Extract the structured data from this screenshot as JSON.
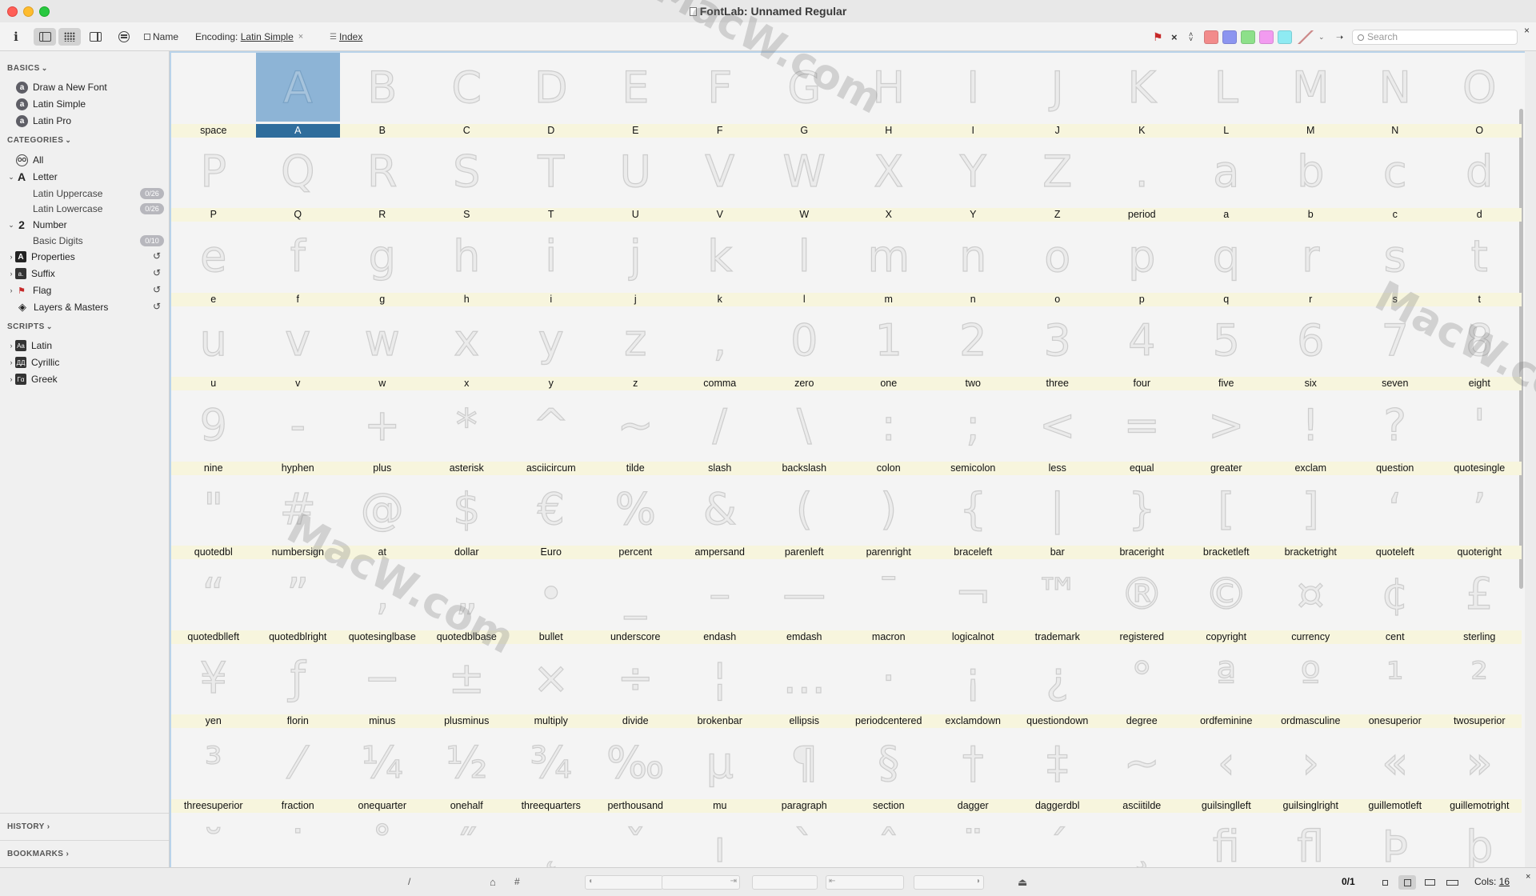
{
  "window": {
    "title": "FontLab: Unnamed Regular"
  },
  "toolbar": {
    "info_label": "i",
    "name_label": "Name",
    "encoding_label": "Encoding:",
    "encoding_value": "Latin Simple",
    "encoding_close": "×",
    "index_label": "Index",
    "flag_close": "×",
    "search_placeholder": "Search",
    "close_x": "×",
    "colors": {
      "red": "#f28b8b",
      "blue": "#8c95f0",
      "green": "#8de08a",
      "magenta": "#f29bf0",
      "cyan": "#8eeaf2"
    }
  },
  "sidebar": {
    "basics_title": "BASICS",
    "basics": [
      {
        "label": "Draw a New Font"
      },
      {
        "label": "Latin Simple"
      },
      {
        "label": "Latin Pro"
      }
    ],
    "categories_title": "CATEGORIES",
    "all_label": "All",
    "all_icon_text": "OO",
    "letter_label": "Letter",
    "letter_icon": "A",
    "latin_upper": {
      "label": "Latin Uppercase",
      "badge": "0/26"
    },
    "latin_lower": {
      "label": "Latin Lowercase",
      "badge": "0/26"
    },
    "number_label": "Number",
    "number_icon": "2",
    "basic_digits": {
      "label": "Basic Digits",
      "badge": "0/10"
    },
    "properties_label": "Properties",
    "suffix_label": "Suffix",
    "flag_label": "Flag",
    "layers_label": "Layers & Masters",
    "scripts_title": "SCRIPTS",
    "scripts": [
      {
        "label": "Latin",
        "icon": "Aa"
      },
      {
        "label": "Cyrillic",
        "icon": "ДД"
      },
      {
        "label": "Greek",
        "icon": "Γα"
      }
    ],
    "history_label": "HISTORY",
    "bookmarks_label": "BOOKMARKS"
  },
  "glyph_grid": {
    "columns": 16,
    "selected": "A",
    "cells": [
      {
        "g": "",
        "n": "space"
      },
      {
        "g": "A",
        "n": "A"
      },
      {
        "g": "B",
        "n": "B"
      },
      {
        "g": "C",
        "n": "C"
      },
      {
        "g": "D",
        "n": "D"
      },
      {
        "g": "E",
        "n": "E"
      },
      {
        "g": "F",
        "n": "F"
      },
      {
        "g": "G",
        "n": "G"
      },
      {
        "g": "H",
        "n": "H"
      },
      {
        "g": "I",
        "n": "I"
      },
      {
        "g": "J",
        "n": "J"
      },
      {
        "g": "K",
        "n": "K"
      },
      {
        "g": "L",
        "n": "L"
      },
      {
        "g": "M",
        "n": "M"
      },
      {
        "g": "N",
        "n": "N"
      },
      {
        "g": "O",
        "n": "O"
      },
      {
        "g": "P",
        "n": "P"
      },
      {
        "g": "Q",
        "n": "Q"
      },
      {
        "g": "R",
        "n": "R"
      },
      {
        "g": "S",
        "n": "S"
      },
      {
        "g": "T",
        "n": "T"
      },
      {
        "g": "U",
        "n": "U"
      },
      {
        "g": "V",
        "n": "V"
      },
      {
        "g": "W",
        "n": "W"
      },
      {
        "g": "X",
        "n": "X"
      },
      {
        "g": "Y",
        "n": "Y"
      },
      {
        "g": "Z",
        "n": "Z"
      },
      {
        "g": ".",
        "n": "period"
      },
      {
        "g": "a",
        "n": "a"
      },
      {
        "g": "b",
        "n": "b"
      },
      {
        "g": "c",
        "n": "c"
      },
      {
        "g": "d",
        "n": "d"
      },
      {
        "g": "e",
        "n": "e"
      },
      {
        "g": "f",
        "n": "f"
      },
      {
        "g": "g",
        "n": "g"
      },
      {
        "g": "h",
        "n": "h"
      },
      {
        "g": "i",
        "n": "i"
      },
      {
        "g": "j",
        "n": "j"
      },
      {
        "g": "k",
        "n": "k"
      },
      {
        "g": "l",
        "n": "l"
      },
      {
        "g": "m",
        "n": "m"
      },
      {
        "g": "n",
        "n": "n"
      },
      {
        "g": "o",
        "n": "o"
      },
      {
        "g": "p",
        "n": "p"
      },
      {
        "g": "q",
        "n": "q"
      },
      {
        "g": "r",
        "n": "r"
      },
      {
        "g": "s",
        "n": "s"
      },
      {
        "g": "t",
        "n": "t"
      },
      {
        "g": "u",
        "n": "u"
      },
      {
        "g": "v",
        "n": "v"
      },
      {
        "g": "w",
        "n": "w"
      },
      {
        "g": "x",
        "n": "x"
      },
      {
        "g": "y",
        "n": "y"
      },
      {
        "g": "z",
        "n": "z"
      },
      {
        "g": ",",
        "n": "comma"
      },
      {
        "g": "0",
        "n": "zero"
      },
      {
        "g": "1",
        "n": "one"
      },
      {
        "g": "2",
        "n": "two"
      },
      {
        "g": "3",
        "n": "three"
      },
      {
        "g": "4",
        "n": "four"
      },
      {
        "g": "5",
        "n": "five"
      },
      {
        "g": "6",
        "n": "six"
      },
      {
        "g": "7",
        "n": "seven"
      },
      {
        "g": "8",
        "n": "eight"
      },
      {
        "g": "9",
        "n": "nine"
      },
      {
        "g": "-",
        "n": "hyphen"
      },
      {
        "g": "+",
        "n": "plus"
      },
      {
        "g": "*",
        "n": "asterisk"
      },
      {
        "g": "^",
        "n": "asciicircum"
      },
      {
        "g": "~",
        "n": "tilde"
      },
      {
        "g": "/",
        "n": "slash"
      },
      {
        "g": "\\",
        "n": "backslash"
      },
      {
        "g": ":",
        "n": "colon"
      },
      {
        "g": ";",
        "n": "semicolon"
      },
      {
        "g": "<",
        "n": "less"
      },
      {
        "g": "=",
        "n": "equal"
      },
      {
        "g": ">",
        "n": "greater"
      },
      {
        "g": "!",
        "n": "exclam"
      },
      {
        "g": "?",
        "n": "question"
      },
      {
        "g": "'",
        "n": "quotesingle"
      },
      {
        "g": "\"",
        "n": "quotedbl"
      },
      {
        "g": "#",
        "n": "numbersign"
      },
      {
        "g": "@",
        "n": "at"
      },
      {
        "g": "$",
        "n": "dollar"
      },
      {
        "g": "€",
        "n": "Euro"
      },
      {
        "g": "%",
        "n": "percent"
      },
      {
        "g": "&",
        "n": "ampersand"
      },
      {
        "g": "(",
        "n": "parenleft"
      },
      {
        "g": ")",
        "n": "parenright"
      },
      {
        "g": "{",
        "n": "braceleft"
      },
      {
        "g": "|",
        "n": "bar"
      },
      {
        "g": "}",
        "n": "braceright"
      },
      {
        "g": "[",
        "n": "bracketleft"
      },
      {
        "g": "]",
        "n": "bracketright"
      },
      {
        "g": "‘",
        "n": "quoteleft"
      },
      {
        "g": "’",
        "n": "quoteright"
      },
      {
        "g": "“",
        "n": "quotedblleft"
      },
      {
        "g": "”",
        "n": "quotedblright"
      },
      {
        "g": "‚",
        "n": "quotesinglbase"
      },
      {
        "g": "„",
        "n": "quotedblbase"
      },
      {
        "g": "•",
        "n": "bullet"
      },
      {
        "g": "_",
        "n": "underscore"
      },
      {
        "g": "–",
        "n": "endash"
      },
      {
        "g": "—",
        "n": "emdash"
      },
      {
        "g": "¯",
        "n": "macron"
      },
      {
        "g": "¬",
        "n": "logicalnot"
      },
      {
        "g": "™",
        "n": "trademark"
      },
      {
        "g": "®",
        "n": "registered"
      },
      {
        "g": "©",
        "n": "copyright"
      },
      {
        "g": "¤",
        "n": "currency"
      },
      {
        "g": "¢",
        "n": "cent"
      },
      {
        "g": "£",
        "n": "sterling"
      },
      {
        "g": "¥",
        "n": "yen"
      },
      {
        "g": "ƒ",
        "n": "florin"
      },
      {
        "g": "−",
        "n": "minus"
      },
      {
        "g": "±",
        "n": "plusminus"
      },
      {
        "g": "×",
        "n": "multiply"
      },
      {
        "g": "÷",
        "n": "divide"
      },
      {
        "g": "¦",
        "n": "brokenbar"
      },
      {
        "g": "…",
        "n": "ellipsis"
      },
      {
        "g": "·",
        "n": "periodcentered"
      },
      {
        "g": "¡",
        "n": "exclamdown"
      },
      {
        "g": "¿",
        "n": "questiondown"
      },
      {
        "g": "°",
        "n": "degree"
      },
      {
        "g": "ª",
        "n": "ordfeminine"
      },
      {
        "g": "º",
        "n": "ordmasculine"
      },
      {
        "g": "¹",
        "n": "onesuperior"
      },
      {
        "g": "²",
        "n": "twosuperior"
      },
      {
        "g": "³",
        "n": "threesuperior"
      },
      {
        "g": "⁄",
        "n": "fraction"
      },
      {
        "g": "¼",
        "n": "onequarter"
      },
      {
        "g": "½",
        "n": "onehalf"
      },
      {
        "g": "¾",
        "n": "threequarters"
      },
      {
        "g": "‰",
        "n": "perthousand"
      },
      {
        "g": "µ",
        "n": "mu"
      },
      {
        "g": "¶",
        "n": "paragraph"
      },
      {
        "g": "§",
        "n": "section"
      },
      {
        "g": "†",
        "n": "dagger"
      },
      {
        "g": "‡",
        "n": "daggerdbl"
      },
      {
        "g": "∼",
        "n": "asciitilde"
      },
      {
        "g": "‹",
        "n": "guilsinglleft"
      },
      {
        "g": "›",
        "n": "guilsinglright"
      },
      {
        "g": "«",
        "n": "guillemotleft"
      },
      {
        "g": "»",
        "n": "guillemotright"
      },
      {
        "g": "˘",
        "n": ""
      },
      {
        "g": "˙",
        "n": ""
      },
      {
        "g": "˚",
        "n": ""
      },
      {
        "g": "˝",
        "n": ""
      },
      {
        "g": "˛",
        "n": ""
      },
      {
        "g": "ˇ",
        "n": ""
      },
      {
        "g": "ı",
        "n": ""
      },
      {
        "g": "`",
        "n": ""
      },
      {
        "g": "ˆ",
        "n": ""
      },
      {
        "g": "¨",
        "n": ""
      },
      {
        "g": "´",
        "n": ""
      },
      {
        "g": "¸",
        "n": ""
      },
      {
        "g": "ﬁ",
        "n": ""
      },
      {
        "g": "ﬂ",
        "n": ""
      },
      {
        "g": "Þ",
        "n": ""
      },
      {
        "g": "þ",
        "n": ""
      }
    ]
  },
  "statusbar": {
    "slash_label": "/",
    "hash_label": "#",
    "selection_count": "0/1",
    "cols_label": "Cols:",
    "cols_value": "16",
    "close_x": "×"
  },
  "watermark": {
    "text": "MacW.com"
  }
}
